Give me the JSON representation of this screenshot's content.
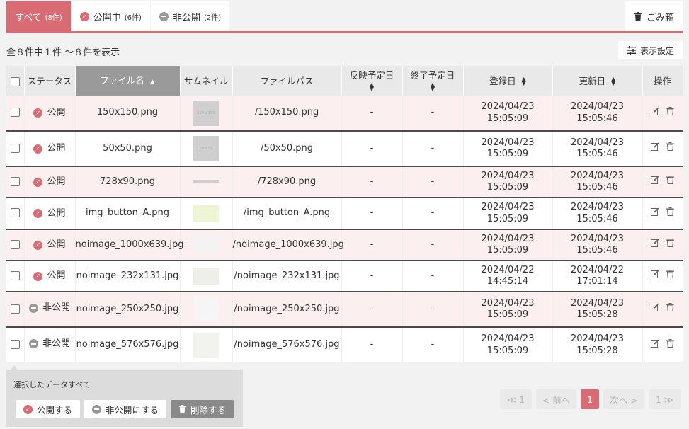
{
  "tabs": [
    {
      "label": "すべて",
      "count": "(8件)",
      "active": true
    },
    {
      "label": "公開中",
      "count": "(6件)",
      "icon": "check-circle-icon"
    },
    {
      "label": "非公開",
      "count": "(2件)",
      "icon": "minus-circle-icon"
    }
  ],
  "trash_label": "ごみ箱",
  "count_text": "全８件中１件 〜８件を表示",
  "display_settings_label": "表示設定",
  "columns": {
    "status": "ステータス",
    "filename": "ファイル名",
    "thumbnail": "サムネイル",
    "filepath": "ファイルパス",
    "publish_date": "反映予定日",
    "end_date": "終了予定日",
    "registered": "登録日",
    "updated": "更新日",
    "actions": "操作"
  },
  "rows": [
    {
      "status": "公開",
      "public": true,
      "filename": "150x150.png",
      "thumb_text": "150 x 150",
      "path": "/150x150.png",
      "publish": "-",
      "end": "-",
      "reg_date": "2024/04/23",
      "reg_time": "15:05:09",
      "upd_date": "2024/04/23",
      "upd_time": "15:05:46"
    },
    {
      "status": "公開",
      "public": true,
      "filename": "50x50.png",
      "thumb_text": "50 x 50",
      "path": "/50x50.png",
      "publish": "-",
      "end": "-",
      "reg_date": "2024/04/23",
      "reg_time": "15:05:09",
      "upd_date": "2024/04/23",
      "upd_time": "15:05:46"
    },
    {
      "status": "公開",
      "public": true,
      "filename": "728x90.png",
      "thumb_text": "",
      "path": "/728x90.png",
      "publish": "-",
      "end": "-",
      "reg_date": "2024/04/23",
      "reg_time": "15:05:09",
      "upd_date": "2024/04/23",
      "upd_time": "15:05:46"
    },
    {
      "status": "公開",
      "public": true,
      "filename": "img_button_A.png",
      "thumb_text": "",
      "path": "/img_button_A.png",
      "publish": "-",
      "end": "-",
      "reg_date": "2024/04/23",
      "reg_time": "15:05:09",
      "upd_date": "2024/04/23",
      "upd_time": "15:05:46"
    },
    {
      "status": "公開",
      "public": true,
      "filename": "noimage_1000x639.jpg",
      "thumb_text": "",
      "path": "/noimage_1000x639.jpg",
      "publish": "-",
      "end": "-",
      "reg_date": "2024/04/23",
      "reg_time": "15:05:09",
      "upd_date": "2024/04/23",
      "upd_time": "15:05:46"
    },
    {
      "status": "公開",
      "public": true,
      "filename": "noimage_232x131.jpg",
      "thumb_text": "",
      "path": "/noimage_232x131.jpg",
      "publish": "-",
      "end": "-",
      "reg_date": "2024/04/22",
      "reg_time": "14:45:14",
      "upd_date": "2024/04/22",
      "upd_time": "17:01:14"
    },
    {
      "status": "非公開",
      "public": false,
      "filename": "noimage_250x250.jpg",
      "thumb_text": "",
      "path": "/noimage_250x250.jpg",
      "publish": "-",
      "end": "-",
      "reg_date": "2024/04/23",
      "reg_time": "15:05:09",
      "upd_date": "2024/04/23",
      "upd_time": "15:05:28"
    },
    {
      "status": "非公開",
      "public": false,
      "filename": "noimage_576x576.jpg",
      "thumb_text": "",
      "path": "/noimage_576x576.jpg",
      "publish": "-",
      "end": "-",
      "reg_date": "2024/04/23",
      "reg_time": "15:05:09",
      "upd_date": "2024/04/23",
      "upd_time": "15:05:28"
    }
  ],
  "bulk": {
    "label": "選択したデータすべて",
    "publish": "公開する",
    "unpublish": "非公開にする",
    "delete": "削除する"
  },
  "pagination": {
    "first": "≪ 1",
    "prev": "< 前へ",
    "current": "1",
    "next": "次へ >",
    "last": "1 ≫"
  },
  "colors": {
    "accent": "#d96b74",
    "row_tint": "#fcefef",
    "header_bg": "#e9e9e9",
    "sorted_header": "#9a9a9a"
  }
}
